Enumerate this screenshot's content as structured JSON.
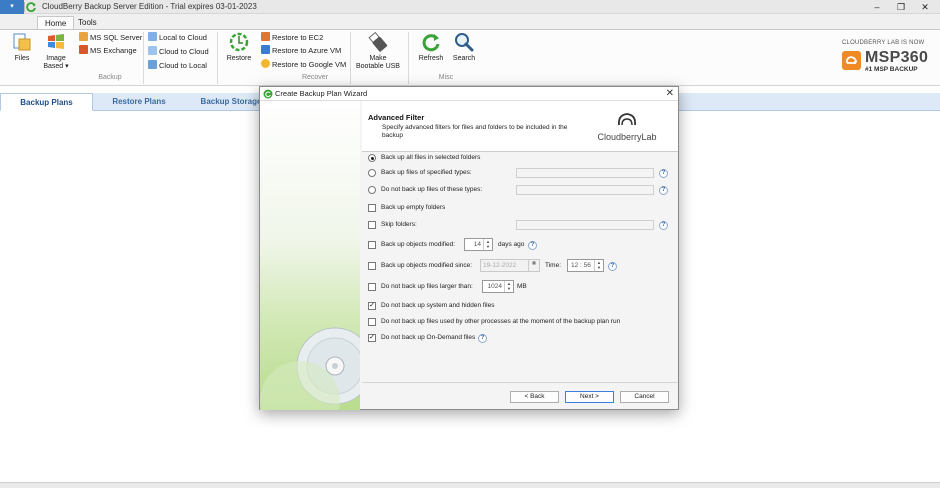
{
  "window": {
    "title": "CloudBerry Backup Server Edition - Trial expires 03-01-2023",
    "minimize_glyph": "–",
    "restore_glyph": "❐",
    "close_glyph": "✕",
    "app_menu_glyph": "▾"
  },
  "ribbon": {
    "tabs": [
      {
        "label": "Home",
        "active": true
      },
      {
        "label": "Tools",
        "active": false
      }
    ],
    "groups": {
      "backup_label": "Backup",
      "recover_label": "Recover",
      "misc_label": "Misc"
    },
    "files_label": "Files",
    "image_label_1": "Image",
    "image_label_2": "Based",
    "ms_sql_label": "MS SQL Server",
    "ms_exchange_label": "MS Exchange",
    "local_to_cloud_label": "Local to Cloud",
    "cloud_to_cloud_label": "Cloud to Cloud",
    "cloud_to_local_label": "Cloud to Local",
    "restore_label": "Restore",
    "restore_ec2_label": "Restore to EC2",
    "restore_azure_label": "Restore to Azure VM",
    "restore_google_label": "Restore to Google VM",
    "make_bootable_label_1": "Make",
    "make_bootable_label_2": "Bootable USB",
    "refresh_label": "Refresh",
    "search_label": "Search"
  },
  "brand": {
    "top": "CLOUDBERRY LAB IS NOW",
    "name": "MSP360",
    "sub": "#1 MSP BACKUP",
    "accent": "#f08a24"
  },
  "main_tabs": [
    {
      "label": "Backup Plans",
      "active": true
    },
    {
      "label": "Restore Plans",
      "active": false
    },
    {
      "label": "Backup Storage",
      "active": false
    }
  ],
  "dialog": {
    "title": "Create Backup Plan Wizard",
    "close_glyph": "✕",
    "header_title": "Advanced Filter",
    "header_desc": "Specify advanced filters for files and folders to be included in the backup",
    "logo_text": "CloudberryLab",
    "options": {
      "backup_all": "Back up all files in selected folders",
      "backup_specified": "Back up files of specified types:",
      "not_backup_types": "Do not back up files of these types:",
      "backup_empty": "Back up empty folders",
      "skip_folders": "Skip folders:",
      "modified_label": "Back up objects modified:",
      "modified_value": "14",
      "modified_unit": "days ago",
      "modified_since": "Back up objects modified since:",
      "since_date": "19-12-2022",
      "time_label": "Time:",
      "time_value": "12 : 56",
      "larger_than": "Do not back up files larger than:",
      "larger_value": "1024",
      "larger_unit": "MB",
      "system_hidden": "Do not back up system and hidden files",
      "used_by_other": "Do not back up files used by other processes at the moment of the backup plan run",
      "on_demand": "Do not back up On-Demand files"
    },
    "help_glyph": "?",
    "check_glyph": "✓",
    "buttons": {
      "back": "< Back",
      "next": "Next >",
      "cancel": "Cancel"
    }
  }
}
